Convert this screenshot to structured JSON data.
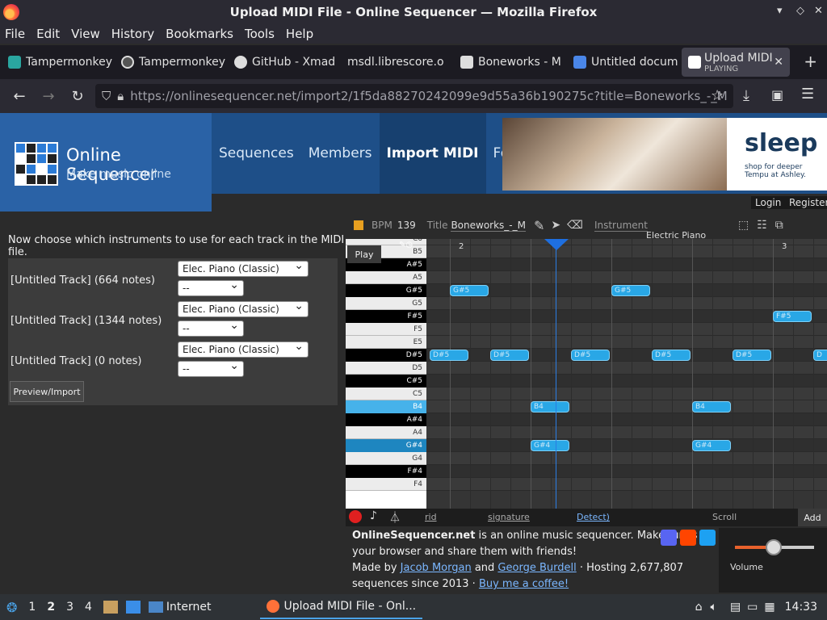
{
  "window": {
    "title": "Upload MIDI File - Online Sequencer — Mozilla Firefox"
  },
  "menu": [
    "File",
    "Edit",
    "View",
    "History",
    "Bookmarks",
    "Tools",
    "Help"
  ],
  "tabs": [
    {
      "label": "Tampermonkey",
      "icon": "tampermonkey-icon",
      "color": "#2aa6a0"
    },
    {
      "label": "Tampermonkey",
      "icon": "tampermonkey-icon",
      "color": "#555555"
    },
    {
      "label": "GitHub - Xmad",
      "icon": "github-icon",
      "color": "#dddddd"
    },
    {
      "label": "msdl.librescore.o",
      "icon": "",
      "color": ""
    },
    {
      "label": "Boneworks - M",
      "icon": "musescore-icon",
      "color": "#dddddd"
    },
    {
      "label": "Untitled docum",
      "icon": "docs-icon",
      "color": "#4a86e8"
    }
  ],
  "active_tab": {
    "label": "Upload MIDI",
    "status": "PLAYING"
  },
  "url": {
    "host": "https://onlinesequencer.net",
    "path": "/import2/1f5da88270242099e9d55a36b190275c?title=Boneworks_-_M"
  },
  "site": {
    "title": "Online Sequencer",
    "subtitle": "Make music online",
    "nav": [
      "Sequences",
      "Members",
      "Import MIDI",
      "Forum"
    ],
    "active_nav": "Import MIDI",
    "ad_headline": "sleep d",
    "ad_small": "shop for deeper Tempu at Ashley.",
    "login": "Login",
    "register": "Register"
  },
  "import": {
    "instructions": "Now choose which instruments to use for each track in the MIDI file.",
    "tracks": [
      {
        "name": "[Untitled Track] (664 notes)",
        "instrument": "Elec. Piano (Classic)",
        "sub": "--"
      },
      {
        "name": "[Untitled Track] (1344 notes)",
        "instrument": "Elec. Piano (Classic)",
        "sub": "--"
      },
      {
        "name": "[Untitled Track] (0 notes)",
        "instrument": "Elec. Piano (Classic)",
        "sub": "--"
      }
    ],
    "preview_button": "Preview/Import"
  },
  "sequencer": {
    "bpm_label": "BPM",
    "bpm": "139",
    "title_label": "Title",
    "title": "Boneworks_-_M",
    "instrument_label": "Instrument",
    "instrument": "Electric Piano",
    "play": "Play",
    "bar_markers": [
      "2",
      "3"
    ],
    "keys": [
      "C6",
      "B5",
      "A#5",
      "A5",
      "G#5",
      "G5",
      "F#5",
      "F5",
      "E5",
      "D#5",
      "D5",
      "C#5",
      "C5",
      "B4",
      "A#4",
      "A4",
      "G#4",
      "G4",
      "F#4",
      "F4"
    ],
    "highlighted_keys": [
      "B4",
      "G#4"
    ],
    "notes": [
      {
        "label": "G#5",
        "row": 4,
        "col": 0
      },
      {
        "label": "G#5",
        "row": 4,
        "col": 8
      },
      {
        "label": "F#5",
        "row": 6,
        "col": 16
      },
      {
        "label": "D#5",
        "row": 9,
        "col": -1
      },
      {
        "label": "D#5",
        "row": 9,
        "col": 2
      },
      {
        "label": "D#5",
        "row": 9,
        "col": 6
      },
      {
        "label": "D#5",
        "row": 9,
        "col": 10
      },
      {
        "label": "D#5",
        "row": 9,
        "col": 14
      },
      {
        "label": "D",
        "row": 9,
        "col": 18
      },
      {
        "label": "B4",
        "row": 13,
        "col": 4
      },
      {
        "label": "B4",
        "row": 13,
        "col": 12
      },
      {
        "label": "G#4",
        "row": 16,
        "col": 4
      },
      {
        "label": "G#4",
        "row": 16,
        "col": 12
      }
    ],
    "bottom_labels": [
      "rid",
      "signature",
      "Detect)",
      "Scroll",
      "Add"
    ],
    "volume_label": "Volume"
  },
  "footer": {
    "brand": "OnlineSequencer.net",
    "text1": " is an online music sequencer. Make tunes in your browser and share them with friends!",
    "made_by": "Made by ",
    "author1": "Jacob Morgan",
    "and": " and ",
    "author2": "George Burdell",
    "hosting": " · Hosting 2,677,807 sequences since 2013 · ",
    "coffee": "Buy me a coffee!"
  },
  "taskbar": {
    "workspaces": [
      "1",
      "2",
      "3",
      "4"
    ],
    "folder": "Internet",
    "window": "Upload MIDI File - Onl...",
    "time": "14:33"
  },
  "colors": {
    "accent": "#2a62a6",
    "note": "#29a7e6",
    "playhead": "#1e6fe0"
  }
}
